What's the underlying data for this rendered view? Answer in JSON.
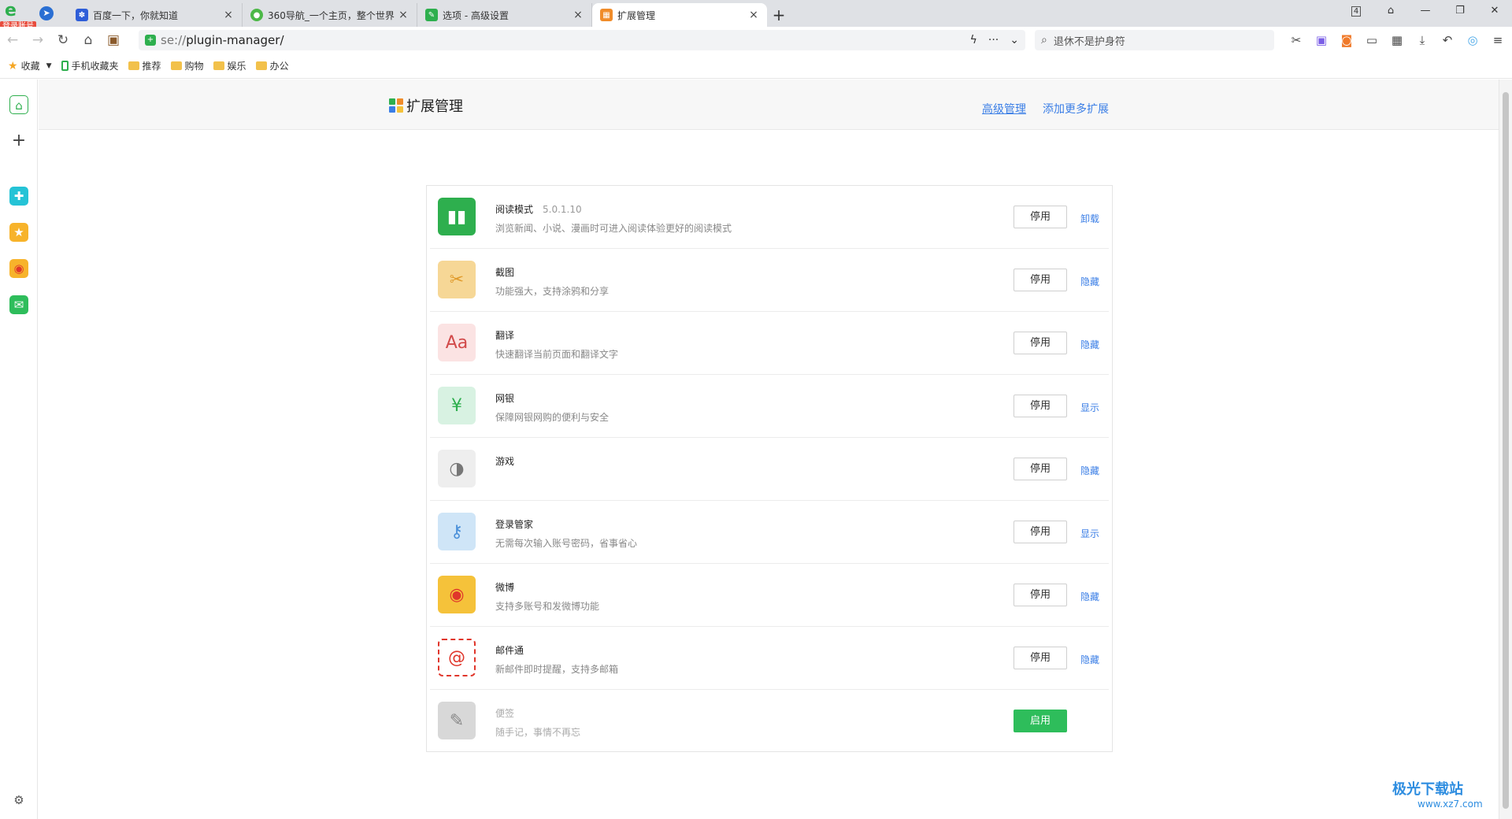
{
  "browser": {
    "login_badge": "登录账号",
    "tabs": [
      {
        "title": "百度一下，你就知道",
        "close": "×"
      },
      {
        "title": "360导航_一个主页，整个世界",
        "close": "×"
      },
      {
        "title": "选项 - 高级设置",
        "close": "×"
      },
      {
        "title": "扩展管理",
        "close": "×"
      }
    ],
    "new_tab": "+",
    "tab_count": "4",
    "address": {
      "scheme": "se://",
      "path": "plugin-manager/"
    },
    "search_placeholder": "退休不是护身符"
  },
  "bookmarks": [
    {
      "label": "收藏"
    },
    {
      "label": "手机收藏夹"
    },
    {
      "label": "推荐"
    },
    {
      "label": "购物"
    },
    {
      "label": "娱乐"
    },
    {
      "label": "办公"
    }
  ],
  "page": {
    "title": "扩展管理",
    "advanced_link": "高级管理",
    "add_more_link": "添加更多扩展"
  },
  "extensions": [
    {
      "name": "阅读模式",
      "version": "5.0.1.10",
      "desc": "浏览新闻、小说、漫画时可进入阅读体验更好的阅读模式",
      "button": "停用",
      "action": "卸载",
      "icon": "book-icon",
      "color": "#2eaf4e"
    },
    {
      "name": "截图",
      "version": "",
      "desc": "功能强大，支持涂鸦和分享",
      "button": "停用",
      "action": "隐藏",
      "icon": "scissors-icon",
      "color": "#f6d796"
    },
    {
      "name": "翻译",
      "version": "",
      "desc": "快速翻译当前页面和翻译文字",
      "button": "停用",
      "action": "隐藏",
      "icon": "translate-icon",
      "color": "#fbe3e3"
    },
    {
      "name": "网银",
      "version": "",
      "desc": "保障网银网购的便利与安全",
      "button": "停用",
      "action": "显示",
      "icon": "shield-yen-icon",
      "color": "#d8f2e2"
    },
    {
      "name": "游戏",
      "version": "",
      "desc": "",
      "button": "停用",
      "action": "隐藏",
      "icon": "gamepad-icon",
      "color": "#eeeeee"
    },
    {
      "name": "登录管家",
      "version": "",
      "desc": "无需每次输入账号密码，省事省心",
      "button": "停用",
      "action": "显示",
      "icon": "key-icon",
      "color": "#cfe5f7"
    },
    {
      "name": "微博",
      "version": "",
      "desc": "支持多账号和发微博功能",
      "button": "停用",
      "action": "隐藏",
      "icon": "weibo-icon",
      "color": "#f5c23a"
    },
    {
      "name": "邮件通",
      "version": "",
      "desc": "新邮件即时提醒，支持多邮箱",
      "button": "停用",
      "action": "隐藏",
      "icon": "mail-at-icon",
      "color": "#ffffff"
    },
    {
      "name": "便签",
      "version": "",
      "desc": "随手记，事情不再忘",
      "button": "启用",
      "action": "",
      "icon": "notepad-icon",
      "color": "#d8d8d8"
    }
  ],
  "watermark": {
    "title": "极光下载站",
    "url": "www.xz7.com"
  }
}
